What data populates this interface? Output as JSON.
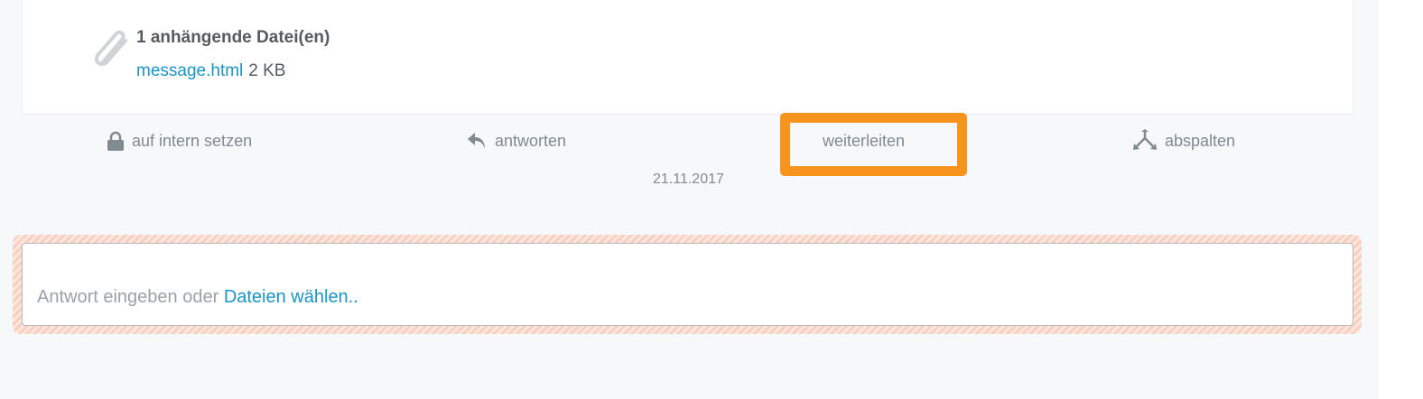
{
  "attachments": {
    "title": "1 anhängende Datei(en)",
    "files": [
      {
        "name": "message.html",
        "size": "2 KB"
      }
    ],
    "icon": "paperclip-icon"
  },
  "actions": [
    {
      "label": "auf intern setzen",
      "icon": "lock-icon"
    },
    {
      "label": "antworten",
      "icon": "reply-icon"
    },
    {
      "label": "weiterleiten",
      "icon": ""
    },
    {
      "label": "abspalten",
      "icon": "split-icon"
    }
  ],
  "highlight": {
    "target": "weiterleiten",
    "color": "#f7941d"
  },
  "article_date": "21.11.2017",
  "reply": {
    "placeholder_prefix": "Antwort eingeben oder ",
    "placeholder_link": "Dateien wählen.."
  },
  "colors": {
    "link": "#1a95c9",
    "text_muted": "#808a91",
    "text_dark": "#555b5f",
    "highlight": "#f7941d",
    "background": "#f7f8f9"
  }
}
